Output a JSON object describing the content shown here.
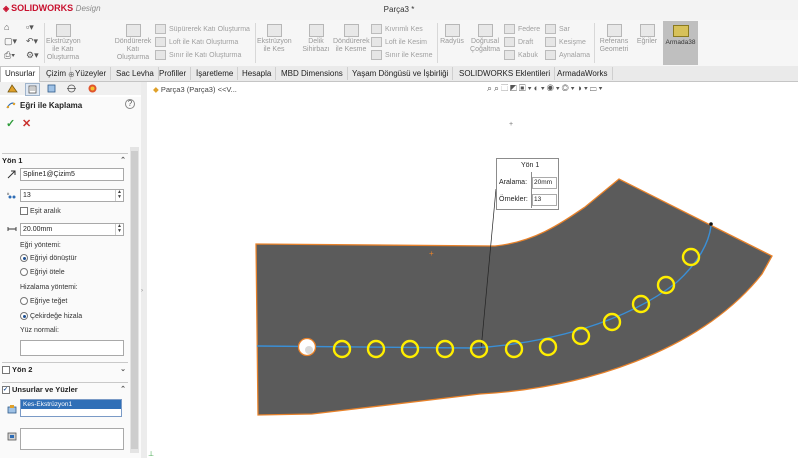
{
  "app": {
    "brand": "SOLIDWORKS",
    "edition": "Design",
    "document_title": "Parça3 *"
  },
  "ribbon": {
    "features_big": [
      {
        "label": "Ekstrüzyon\nile Katı\nOluşturma"
      },
      {
        "label": "Döndürerek\nKatı\nOluşturma"
      },
      {
        "label": "Ekstrüzyon\nile Kes"
      },
      {
        "label": "Delik\nSihirbazı"
      },
      {
        "label": "Döndürerek\nile Kesme"
      },
      {
        "label": "Radyüs"
      },
      {
        "label": "Doğrusal\nÇoğaltma"
      },
      {
        "label": "Referans\nGeometri"
      },
      {
        "label": "Eğriler"
      }
    ],
    "features_small": [
      {
        "label": "Süpürerek Katı Oluşturma"
      },
      {
        "label": "Loft ile Katı Oluşturma"
      },
      {
        "label": "Sınır ile Katı Oluşturma"
      },
      {
        "label": "Kıvrımlı Kes"
      },
      {
        "label": "Loft ile Kesim"
      },
      {
        "label": "Sınır ile Kesme"
      },
      {
        "label": "Federe"
      },
      {
        "label": "Draft"
      },
      {
        "label": "Kabuk"
      },
      {
        "label": "Sar"
      },
      {
        "label": "Kesişme"
      },
      {
        "label": "Aynalama"
      }
    ],
    "addon_button": {
      "label": "Armada38"
    }
  },
  "tabs": [
    {
      "label": "Unsurlar",
      "active": true
    },
    {
      "label": "Çizim"
    },
    {
      "label": "Yüzeyler"
    },
    {
      "label": "Sac Levha"
    },
    {
      "label": "Profiller"
    },
    {
      "label": "İşaretleme"
    },
    {
      "label": "Hesapla"
    },
    {
      "label": "MBD Dimensions"
    },
    {
      "label": "Yaşam Döngüsü ve İşbirliği"
    },
    {
      "label": "SOLIDWORKS Eklentileri"
    },
    {
      "label": "ArmadaWorks"
    }
  ],
  "property_manager": {
    "title": "Eğri ile Kaplama",
    "ok_symbol": "✓",
    "cancel_symbol": "✕",
    "direction1": {
      "header": "Yön 1",
      "curve_value": "Spline1@Çizim5",
      "instances_value": "13",
      "equal_spacing_label": "Eşit aralık",
      "spacing_value": "20.00mm",
      "curve_method_label": "Eğri yöntemi:",
      "curve_method_options": [
        {
          "label": "Eğriyi dönüştür",
          "selected": true
        },
        {
          "label": "Eğriyi ötele",
          "selected": false
        }
      ],
      "alignment_method_label": "Hizalama yöntemi:",
      "alignment_method_options": [
        {
          "label": "Eğriye teğet",
          "selected": false
        },
        {
          "label": "Çekirdeğe hizala",
          "selected": true
        }
      ],
      "face_normal_label": "Yüz normali:"
    },
    "direction2": {
      "header": "Yön 2"
    },
    "features_faces": {
      "header": "Unsurlar ve Yüzler",
      "selected_item": "Kes-Ekstrüzyon1"
    }
  },
  "canvas": {
    "breadcrumb": "Parça3 (Parça3) <<V...",
    "callout": {
      "title": "Yön 1",
      "spacing_label": "Aralama:",
      "spacing_value": "20mm",
      "instances_label": "Örnekler:",
      "instances_value": "13"
    },
    "colors": {
      "body": "#5b5b5b",
      "edge": "#e8822a",
      "curve": "#3a8fd6",
      "instance": "#ffee00"
    },
    "pattern_instances": 13
  }
}
